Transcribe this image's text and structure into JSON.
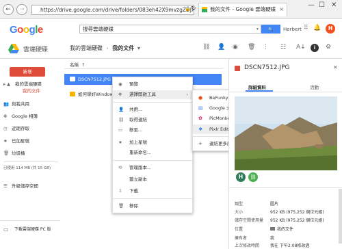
{
  "browser": {
    "url": "https://drive.google.com/drive/folders/083eh42X9mvzgZDJXNTB",
    "tab_title": "我的文件 - Google 雲端硬碟",
    "back_glyph": "←",
    "forward_glyph": "→",
    "lock_glyph": "🔒",
    "refresh_glyph": "↻",
    "close_tab_glyph": "×",
    "minimize_glyph": "—",
    "maximize_glyph": "☐",
    "close_glyph": "✕"
  },
  "google_header": {
    "logo": "Google",
    "search_value": "搜尋雲端硬碟",
    "search_button_glyph": "🔍",
    "user_name": "Herbert",
    "avatar_letter": "H",
    "brand_colors": [
      "#4285f4",
      "#ea4335",
      "#fbbc05",
      "#4285f4",
      "#34a853",
      "#ea4335"
    ]
  },
  "drive_bar": {
    "title": "雲端硬碟",
    "breadcrumb_root": "我的雲端硬碟",
    "breadcrumb_sep": "›",
    "breadcrumb_current": "我的文件",
    "breadcrumb_dropdown": "▾",
    "toolbar_icons": [
      "link-icon",
      "person-add-icon",
      "eye-icon",
      "trash-icon",
      "more-vert-icon",
      "list-view-icon",
      "sort-icon",
      "info-icon",
      "settings-icon"
    ]
  },
  "sidebar": {
    "new_button": "新增",
    "items": [
      {
        "label": "我的雲端硬碟",
        "icon": "drive-icon",
        "expander": "▸"
      },
      {
        "label": "我的文件",
        "icon": "",
        "expander": ""
      },
      {
        "label": "與我共用",
        "icon": "shared-icon",
        "expander": ""
      },
      {
        "label": "Google 相簿",
        "icon": "photos-icon",
        "expander": ""
      },
      {
        "label": "近期存取",
        "icon": "clock-icon",
        "expander": ""
      },
      {
        "label": "已加星號",
        "icon": "star-icon",
        "expander": ""
      },
      {
        "label": "垃圾桶",
        "icon": "trash-icon",
        "expander": ""
      }
    ],
    "storage": "已使用 114 MB (共 15 GB)",
    "upgrade": "升級儲存空間",
    "download_pc": "下載雲端硬碟 PC 版"
  },
  "main": {
    "column_header": "名稱",
    "sort_arrow": "↑",
    "files": [
      {
        "name": "DSCN7512.JPG",
        "selected": true
      },
      {
        "name": "如何學好Windows",
        "selected": false
      }
    ]
  },
  "context_menu": {
    "items": [
      {
        "label": "預覽",
        "icon": "eye-icon",
        "glyph": "◉"
      },
      {
        "label": "選擇開啟工具",
        "icon": "open-with-icon",
        "glyph": "✥",
        "arrow": "›"
      },
      {
        "label": "共用...",
        "icon": "person-add-icon",
        "glyph": "👤"
      },
      {
        "label": "取得連結",
        "icon": "link-icon",
        "glyph": "⛓"
      },
      {
        "label": "移至...",
        "icon": "folder-move-icon",
        "glyph": "▭"
      },
      {
        "label": "加上星號",
        "icon": "star-icon",
        "glyph": "★"
      },
      {
        "label": "重新命名...",
        "icon": "",
        "glyph": ""
      },
      {
        "label": "管理版本...",
        "icon": "history-icon",
        "glyph": "⟲"
      },
      {
        "label": "建立副本",
        "icon": "",
        "glyph": ""
      },
      {
        "label": "下載",
        "icon": "download-icon",
        "glyph": "⇩"
      },
      {
        "label": "移除",
        "icon": "trash-icon",
        "glyph": "🗑"
      }
    ]
  },
  "submenu": {
    "items": [
      {
        "label": "BeFunky Photo Editor",
        "icon": "befunky-icon",
        "glyph": "●",
        "color": "#f4511e"
      },
      {
        "label": "Google 文件",
        "icon": "docs-icon",
        "glyph": "▤",
        "color": "#4285f4"
      },
      {
        "label": "PicMonkey",
        "icon": "picmonkey-icon",
        "glyph": "✿",
        "color": "#e91e63"
      },
      {
        "label": "Pixlr Editor",
        "icon": "pixlr-icon",
        "glyph": "❖",
        "color": "#1a73e8"
      },
      {
        "label": "連結更多應用程式",
        "icon": "add-icon",
        "glyph": "+",
        "color": "#555555"
      }
    ]
  },
  "details": {
    "file_name": "DSCN7512.JPG",
    "close_glyph": "✕",
    "tab_details": "詳細資料",
    "tab_activity": "活動",
    "owner_avatar_letter": "H",
    "share_avatar_icon": "link-icon",
    "rows": [
      {
        "key": "類型",
        "value": "圖片"
      },
      {
        "key": "大小",
        "value": "952 KB (975,252 個位元組)"
      },
      {
        "key": "儲存空間使用量",
        "value": "952 KB (975,252 個位元組)"
      },
      {
        "key": "位置",
        "value": "我的文件"
      },
      {
        "key": "擁有者",
        "value": "我"
      },
      {
        "key": "上次修改時間",
        "value": "我在 下午2:08修改過"
      }
    ]
  }
}
